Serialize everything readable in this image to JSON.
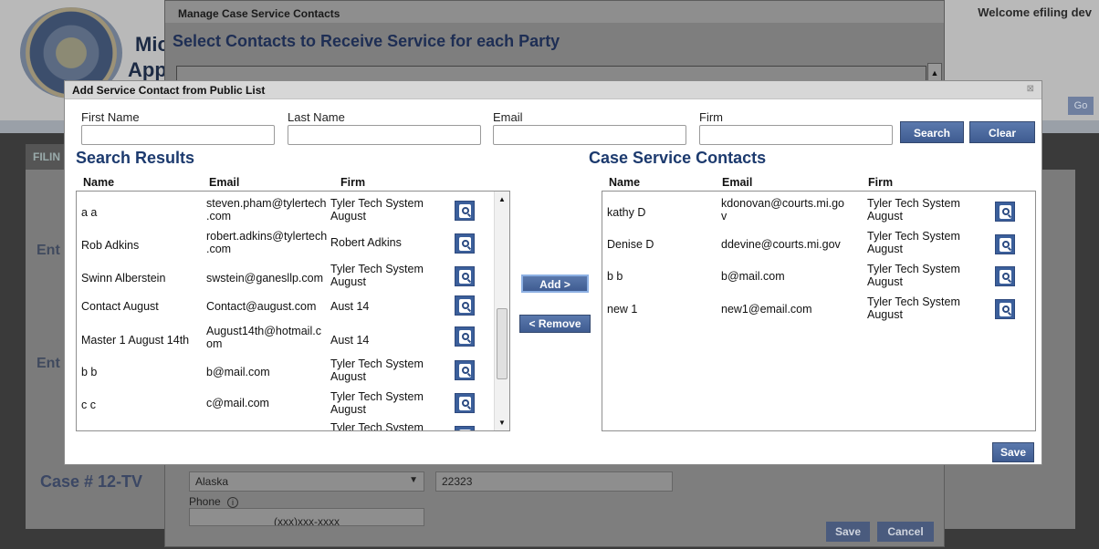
{
  "background": {
    "brand_line1": "Mic",
    "brand_line2": "App",
    "welcome": "Welcome efiling dev",
    "go_label": "Go",
    "tab_label": "FILIN",
    "case_heading": "Case # 12-TV",
    "side_text_1": "Ent",
    "side_text_2": "Ent"
  },
  "manage_dialog": {
    "title": "Manage Case Service Contacts",
    "heading": "Select Contacts to Receive Service for each Party",
    "state_value": "Alaska",
    "zip_value": "22323",
    "phone_label": "Phone",
    "phone_placeholder": "(xxx)xxx-xxxx",
    "save_label": "Save",
    "cancel_label": "Cancel"
  },
  "modal": {
    "title": "Add Service Contact from Public List",
    "close_glyph": "⊠",
    "filters": {
      "first_name_label": "First Name",
      "last_name_label": "Last Name",
      "email_label": "Email",
      "firm_label": "Firm",
      "first_name_value": "",
      "last_name_value": "",
      "email_value": "",
      "firm_value": ""
    },
    "search_label": "Search",
    "clear_label": "Clear",
    "add_label": "Add >",
    "remove_label": "< Remove",
    "save_label": "Save",
    "search_results": {
      "title": "Search Results",
      "columns": [
        "Name",
        "Email",
        "Firm"
      ],
      "rows": [
        {
          "name": "a a",
          "email_1": "steven.pham@tylertech",
          "email_2": ".com",
          "firm_1": "Tyler Tech System",
          "firm_2": "August"
        },
        {
          "name": "Rob Adkins",
          "email_1": "robert.adkins@tylertech",
          "email_2": ".com",
          "firm_1": "Robert Adkins",
          "firm_2": ""
        },
        {
          "name": "Swinn Alberstein",
          "email_1": "swstein@ganesllp.com",
          "email_2": "",
          "firm_1": "Tyler Tech System",
          "firm_2": "August"
        },
        {
          "name": "Contact August",
          "email_1": "Contact@august.com",
          "email_2": "",
          "firm_1": "Aust 14",
          "firm_2": ""
        },
        {
          "name": "Master 1 August 14th",
          "email_1": "August14th@hotmail.c",
          "email_2": "om",
          "firm_1": "Aust 14",
          "firm_2": ""
        },
        {
          "name": "b b",
          "email_1": "b@mail.com",
          "email_2": "",
          "firm_1": "Tyler Tech System",
          "firm_2": "August"
        },
        {
          "name": "c c",
          "email_1": "c@mail.com",
          "email_2": "",
          "firm_1": "Tyler Tech System",
          "firm_2": "August"
        },
        {
          "name": "",
          "email_1": "",
          "email_2": "",
          "firm_1": "Tyler Tech System",
          "firm_2": ""
        }
      ]
    },
    "case_contacts": {
      "title": "Case Service Contacts",
      "columns": [
        "Name",
        "Email",
        "Firm"
      ],
      "rows": [
        {
          "name": "kathy D",
          "email_1": "kdonovan@courts.mi.go",
          "email_2": "v",
          "firm_1": "Tyler Tech System",
          "firm_2": "August"
        },
        {
          "name": "Denise D",
          "email_1": "ddevine@courts.mi.gov",
          "email_2": "",
          "firm_1": "Tyler Tech System",
          "firm_2": "August"
        },
        {
          "name": "b b",
          "email_1": "b@mail.com",
          "email_2": "",
          "firm_1": "Tyler Tech System",
          "firm_2": "August"
        },
        {
          "name": "new 1",
          "email_1": "new1@email.com",
          "email_2": "",
          "firm_1": "Tyler Tech System",
          "firm_2": "August"
        }
      ]
    }
  },
  "colors": {
    "accent": "#3f5c91",
    "heading_blue": "#1c3a6e",
    "overlay": "#7e7e7e"
  },
  "icons": {
    "row_action": "magnifier-icon",
    "close": "close-icon",
    "info": "info-icon"
  }
}
